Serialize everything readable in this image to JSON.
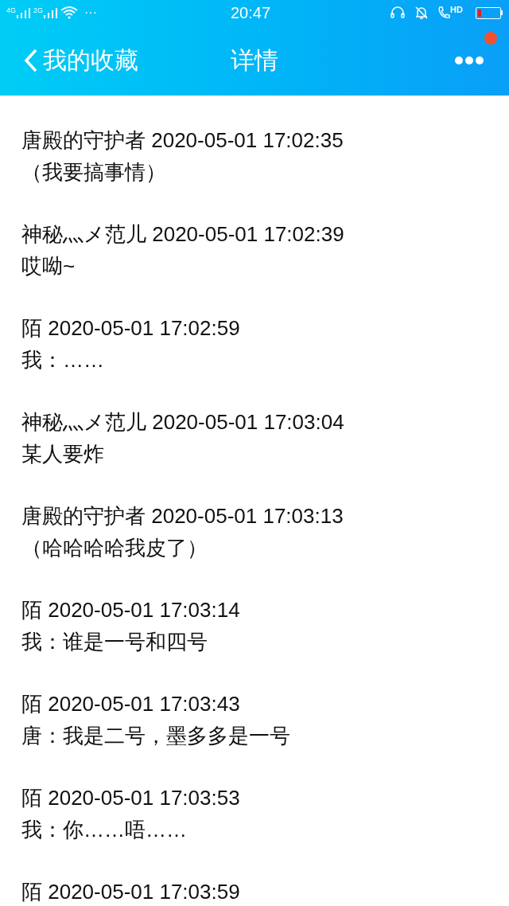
{
  "status_bar": {
    "network_1": "4G",
    "network_2": "2G",
    "more": "···",
    "time": "20:47",
    "call_label": "HD"
  },
  "nav_bar": {
    "back_label": "我的收藏",
    "title": "详情",
    "notification_dot": true
  },
  "messages": [
    {
      "header": "唐殿的守护者 2020-05-01 17:02:35",
      "body": "（我要搞事情）"
    },
    {
      "header": "神秘灬メ范儿 2020-05-01 17:02:39",
      "body": "哎呦~"
    },
    {
      "header": "陌 2020-05-01 17:02:59",
      "body": "我：……"
    },
    {
      "header": "神秘灬メ范儿 2020-05-01 17:03:04",
      "body": "某人要炸"
    },
    {
      "header": "唐殿的守护者 2020-05-01 17:03:13",
      "body": "（哈哈哈哈我皮了）"
    },
    {
      "header": "陌 2020-05-01 17:03:14",
      "body": "我：谁是一号和四号"
    },
    {
      "header": "陌 2020-05-01 17:03:43",
      "body": "唐：我是二号，墨多多是一号"
    },
    {
      "header": "陌 2020-05-01 17:03:53",
      "body": "我：你……唔……"
    },
    {
      "header": "陌 2020-05-01 17:03:59"
    }
  ]
}
